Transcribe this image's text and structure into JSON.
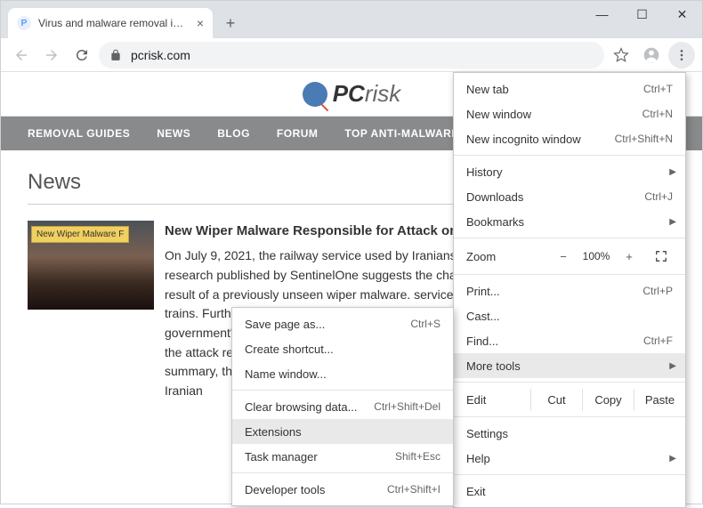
{
  "tab": {
    "title": "Virus and malware removal instru",
    "favicon_letter": "P"
  },
  "window": {
    "minimize": "—",
    "maximize": "☐",
    "close": "✕"
  },
  "toolbar": {
    "newtab": "+",
    "url": "pcrisk.com"
  },
  "site": {
    "logo_bold": "PC",
    "logo_light": "risk",
    "nav": [
      "REMOVAL GUIDES",
      "NEWS",
      "BLOG",
      "FORUM",
      "TOP ANTI-MALWARE"
    ]
  },
  "page": {
    "heading": "News",
    "thumb_badge": "New Wiper Malware F",
    "article_title": "New Wiper Malware Responsible for Attack on",
    "article_body": "On July 9, 2021, the railway service used by Iranians daily suffered a cyber attack. New research published by SentinelOne suggests the chaos caused during the attack was a result of a previously unseen wiper malware.                                                                        services experienced delays of scheduled trains. Further, the electronic tracking system used by the service also failed. The government's official response came from the ministry saying. The Guardian reported that the attack resulted in \"unprecedented chaos\" with hundreds of trains delayed or canceled. In summary, the attack caused significant disruption in … computer systems of the staff of the Iranian"
  },
  "main_menu": {
    "new_tab": "New tab",
    "new_tab_sc": "Ctrl+T",
    "new_window": "New window",
    "new_window_sc": "Ctrl+N",
    "incognito": "New incognito window",
    "incognito_sc": "Ctrl+Shift+N",
    "history": "History",
    "downloads": "Downloads",
    "downloads_sc": "Ctrl+J",
    "bookmarks": "Bookmarks",
    "zoom": "Zoom",
    "zoom_value": "100%",
    "print": "Print...",
    "print_sc": "Ctrl+P",
    "cast": "Cast...",
    "find": "Find...",
    "find_sc": "Ctrl+F",
    "more_tools": "More tools",
    "edit": "Edit",
    "cut": "Cut",
    "copy": "Copy",
    "paste": "Paste",
    "settings": "Settings",
    "help": "Help",
    "exit": "Exit"
  },
  "sub_menu": {
    "save_page": "Save page as...",
    "save_page_sc": "Ctrl+S",
    "create_shortcut": "Create shortcut...",
    "name_window": "Name window...",
    "clear_data": "Clear browsing data...",
    "clear_data_sc": "Ctrl+Shift+Del",
    "extensions": "Extensions",
    "task_manager": "Task manager",
    "task_manager_sc": "Shift+Esc",
    "dev_tools": "Developer tools",
    "dev_tools_sc": "Ctrl+Shift+I"
  }
}
